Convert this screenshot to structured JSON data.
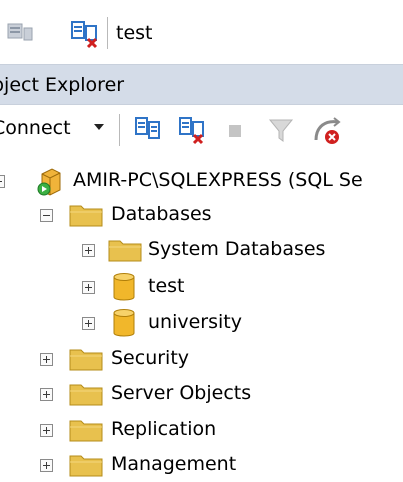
{
  "toolbar": {
    "current_database": "test"
  },
  "object_explorer": {
    "title": "bject Explorer",
    "connect_label": "Connect",
    "tree": {
      "server": "AMIR-PC\\SQLEXPRESS (SQL Se",
      "databases": "Databases",
      "system_databases": "System Databases",
      "db_test": "test",
      "db_university": "university",
      "security": "Security",
      "server_objects": "Server Objects",
      "replication": "Replication",
      "management": "Management"
    }
  },
  "colors": {
    "header_bg": "#d4dce8",
    "folder": "#e8c14e",
    "database": "#f1b72b"
  }
}
